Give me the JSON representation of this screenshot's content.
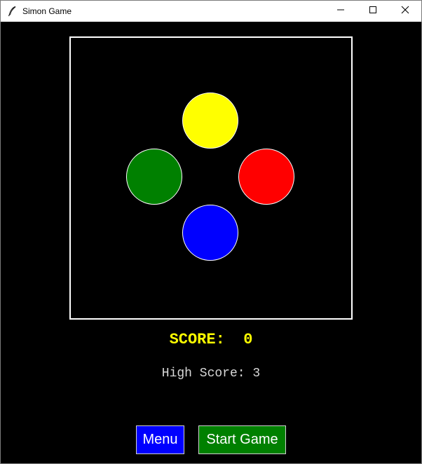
{
  "window": {
    "title": "Simon Game"
  },
  "icons": {
    "app": "feather-icon",
    "minimize": "minimize-icon",
    "maximize": "maximize-icon",
    "close": "close-icon"
  },
  "game": {
    "pads": [
      {
        "name": "yellow",
        "color": "#ffff00"
      },
      {
        "name": "green",
        "color": "#008000"
      },
      {
        "name": "red",
        "color": "#ff0000"
      },
      {
        "name": "blue",
        "color": "#0000ff"
      }
    ],
    "score_label": "SCORE:",
    "score_value": "0",
    "high_score_label": "High Score:",
    "high_score_value": "3"
  },
  "buttons": {
    "menu_label": "Menu",
    "start_label": "Start Game"
  },
  "colors": {
    "background": "#000000",
    "score_text": "#ffff00",
    "high_score_text": "#d9d9d9",
    "menu_button": "#0000ff",
    "start_button": "#008000",
    "board_border": "#ffffff"
  }
}
